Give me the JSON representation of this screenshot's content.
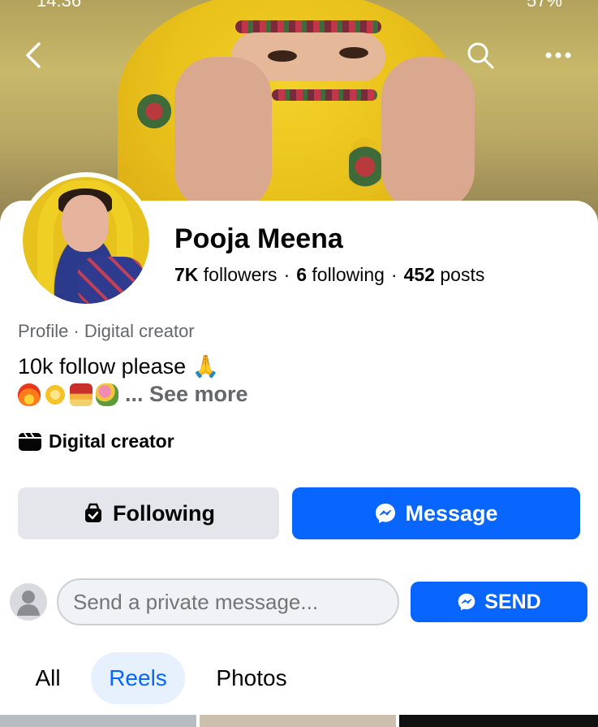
{
  "status_bar": {
    "time": "14:36",
    "right": "57%"
  },
  "profile": {
    "name": "Pooja Meena",
    "followers_count": "7K",
    "followers_label": "followers",
    "following_count": "6",
    "following_label": "following",
    "posts_count": "452",
    "posts_label": "posts",
    "category": "Profile · Digital creator",
    "bio_line1": "10k follow please 🙏",
    "see_more": "... See more",
    "detail": "Digital creator"
  },
  "actions": {
    "following_label": "Following",
    "message_label": "Message"
  },
  "private_message": {
    "placeholder": "Send a private message...",
    "send_label": "SEND"
  },
  "tabs": {
    "all": "All",
    "reels": "Reels",
    "photos": "Photos"
  },
  "colors": {
    "accent": "#0866ff",
    "secondary_button": "#e4e6eb",
    "tab_active_bg": "#e7f1fe"
  },
  "icons": [
    "back-arrow-icon",
    "search-icon",
    "more-icon",
    "clapper-icon",
    "following-check-icon",
    "messenger-icon",
    "user-placeholder-icon"
  ]
}
